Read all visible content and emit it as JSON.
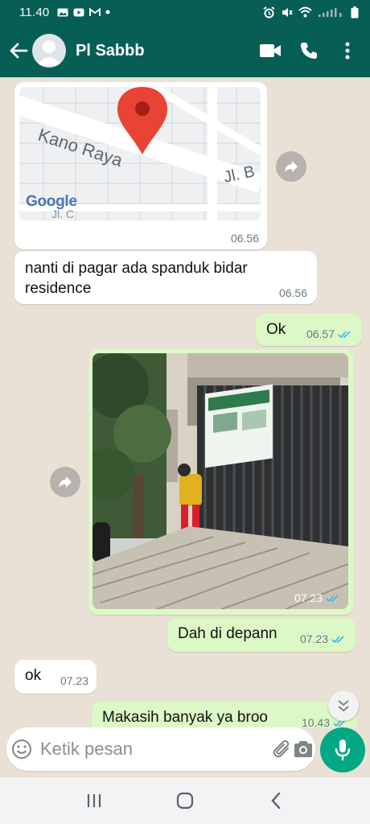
{
  "status_bar": {
    "time": "11.40",
    "left_icons": [
      "image-icon",
      "youtube-icon",
      "gmail-icon",
      "dot-icon"
    ],
    "right_icons": [
      "alarm-icon",
      "mute-icon",
      "wifi-icon",
      "signal-icon",
      "battery-icon"
    ]
  },
  "header": {
    "contact_name": "Pl Sabbb",
    "icons": [
      "back-arrow-icon",
      "video-call-icon",
      "phone-icon",
      "more-vert-icon"
    ]
  },
  "messages": [
    {
      "type": "location",
      "direction": "in",
      "map_street_text": "Kano Raya",
      "map_text_2": "Jl. B",
      "map_text_3": "Jl. C",
      "map_logo": "Google",
      "time": "06.56"
    },
    {
      "type": "text",
      "direction": "in",
      "text_line1": "nanti di pagar ada spanduk bidar",
      "text_line2": "residence",
      "time": "06.56"
    },
    {
      "type": "text",
      "direction": "out",
      "text": "Ok",
      "time": "06.57",
      "status": "read"
    },
    {
      "type": "image",
      "direction": "out",
      "caption": "",
      "time": "07.23",
      "status": "read"
    },
    {
      "type": "text",
      "direction": "out",
      "text": "Dah di depann",
      "time": "07.23",
      "status": "read"
    },
    {
      "type": "text",
      "direction": "in",
      "text": "ok",
      "time": "07.23"
    },
    {
      "type": "text",
      "direction": "out",
      "text": "Makasih banyak ya broo",
      "time": "10.43",
      "status": "read"
    }
  ],
  "input": {
    "placeholder": "Ketik pesan",
    "icons": [
      "emoji-icon",
      "attach-icon",
      "camera-icon",
      "mic-icon"
    ]
  },
  "colors": {
    "header_bg": "#075e54",
    "chat_bg": "#e9e1d6",
    "outgoing_bubble": "#dcf8c6",
    "incoming_bubble": "#ffffff",
    "read_ticks": "#34b7f1",
    "mic_button": "#00a884"
  },
  "navbar": {
    "icons": [
      "recent-apps-icon",
      "home-icon",
      "back-icon"
    ]
  }
}
